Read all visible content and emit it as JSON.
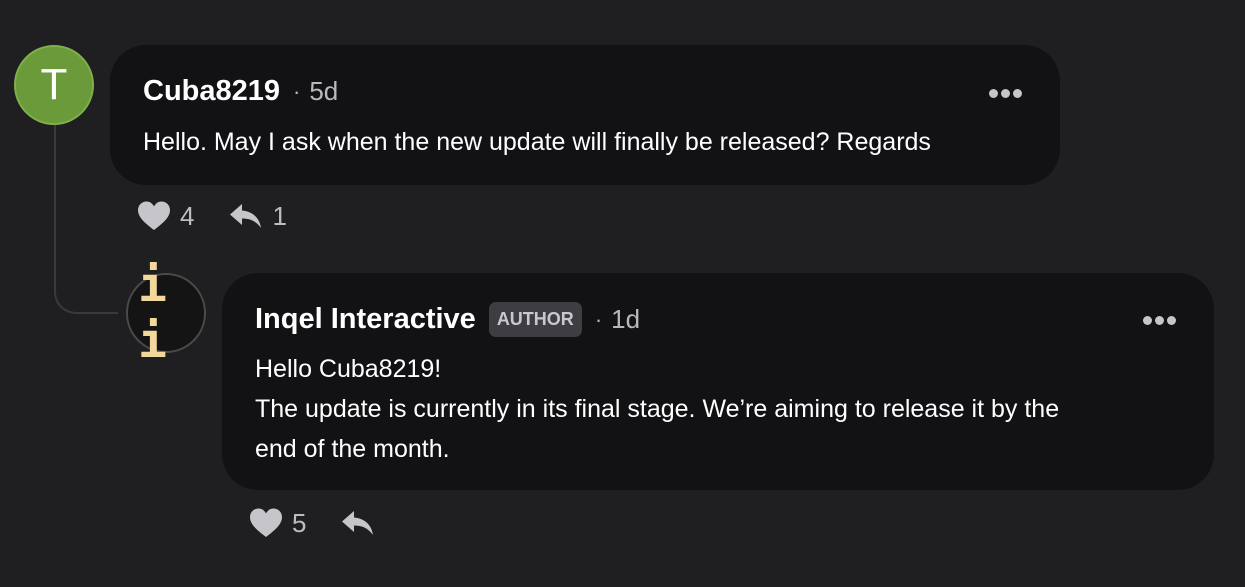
{
  "comments": [
    {
      "avatar_letter": "T",
      "avatar_color": "#6a9a3a",
      "author": "Cuba8219",
      "separator": "·",
      "time": "5d",
      "text": "Hello. May I ask when the new update will finally be released? Regards",
      "likes": "4",
      "replies": "1"
    },
    {
      "avatar_letter": "i i",
      "avatar_color": "#f2d89a",
      "author": "Inqel Interactive",
      "badge": "AUTHOR",
      "separator": "·",
      "time": "1d",
      "text_lines": [
        "Hello Cuba8219!",
        "The update is currently in its final stage. We’re aiming to release it by the",
        "end of the month."
      ],
      "likes": "5"
    }
  ],
  "icons": {
    "like": "heart-icon",
    "reply": "reply-arrow-icon",
    "more": "more-options-icon"
  }
}
